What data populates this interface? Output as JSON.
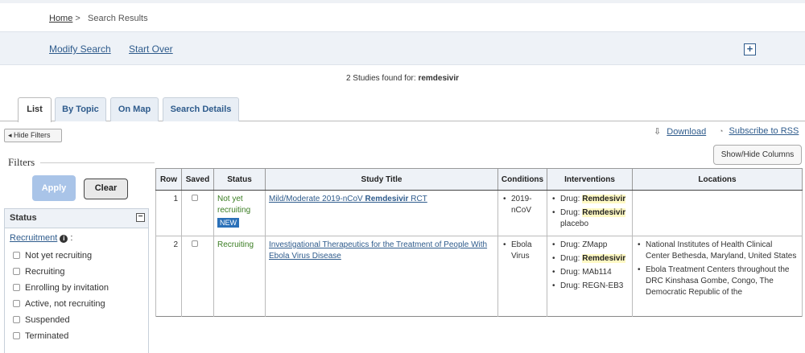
{
  "breadcrumb": {
    "home": "Home",
    "sep": ">",
    "current": "Search Results"
  },
  "actions": {
    "modify": "Modify Search",
    "start_over": "Start Over",
    "plus_icon": "+"
  },
  "summary": {
    "prefix": "2 Studies found for: ",
    "term": "remdesivir"
  },
  "tabs": [
    {
      "label": "List"
    },
    {
      "label": "By Topic"
    },
    {
      "label": "On Map"
    },
    {
      "label": "Search Details"
    }
  ],
  "toolbar": {
    "hide_filters": "Hide Filters",
    "download": "Download",
    "rss": "Subscribe to RSS",
    "show_hide_columns": "Show/Hide Columns"
  },
  "filters": {
    "title": "Filters",
    "apply": "Apply",
    "clear": "Clear",
    "status_header": "Status",
    "recruitment_label": "Recruitment",
    "options": [
      "Not yet recruiting",
      "Recruiting",
      "Enrolling by invitation",
      "Active, not recruiting",
      "Suspended",
      "Terminated"
    ]
  },
  "table": {
    "columns": [
      "Row",
      "Saved",
      "Status",
      "Study Title",
      "Conditions",
      "Interventions",
      "Locations"
    ],
    "rows": [
      {
        "row": "1",
        "status": "Not yet recruiting",
        "badge": "NEW",
        "title_a": "Mild/Moderate 2019-nCoV ",
        "title_b": "Remdesivir",
        "title_c": " RCT",
        "conditions": [
          "2019-nCoV"
        ],
        "interventions": [
          {
            "prefix": "Drug: ",
            "name": "Remdesivir"
          },
          {
            "prefix": "Drug: ",
            "name": "Remdesivir"
          }
        ],
        "interventions_extra": "placebo",
        "locations": []
      },
      {
        "row": "2",
        "status": "Recruiting",
        "title": "Investigational Therapeutics for the Treatment of People With Ebola Virus Disease",
        "conditions": [
          "Ebola Virus"
        ],
        "interventions": [
          {
            "prefix": "Drug: ",
            "name": "ZMapp"
          },
          {
            "prefix": "Drug: ",
            "name": "Remdesivir"
          },
          {
            "prefix": "Drug: ",
            "name": "MAb114"
          },
          {
            "prefix": "Drug: ",
            "name": "REGN-EB3"
          }
        ],
        "locations": [
          "National Institutes of Health Clinical Center Bethesda, Maryland, United States",
          "Ebola Treatment Centers throughout the DRC Kinshasa Gombe, Congo, The Democratic Republic of the"
        ]
      }
    ]
  },
  "colors": {
    "link": "#2e5b8c",
    "green": "#3a7d22",
    "badge": "#2a70b8",
    "highlight": "#fff9c4"
  }
}
